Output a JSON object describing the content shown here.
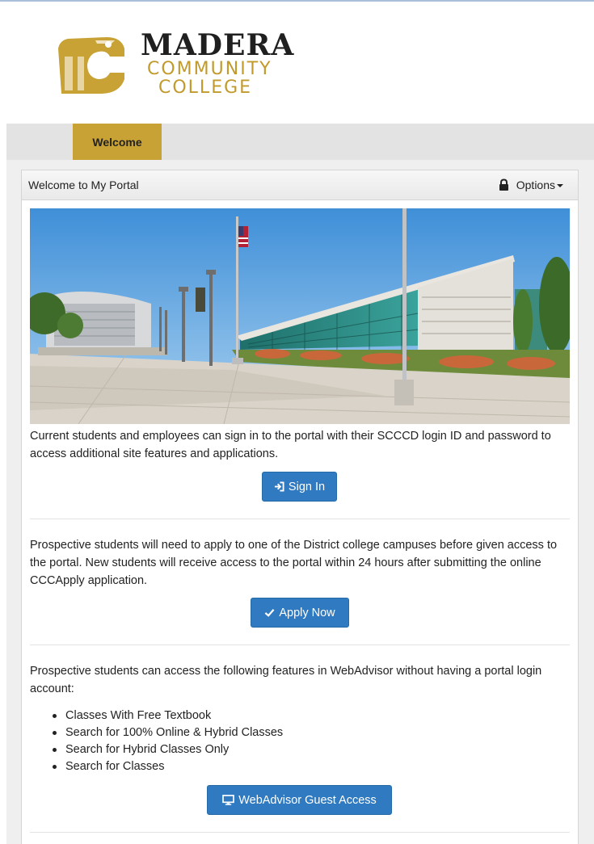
{
  "logo": {
    "line1": "MADERA",
    "line2": "COMMUNITY",
    "line3": "COLLEGE",
    "colors": {
      "gold": "#c9a235",
      "dark": "#1f1f1f"
    }
  },
  "tabs": [
    {
      "label": "Welcome",
      "active": true
    }
  ],
  "panel": {
    "title": "Welcome to My Portal",
    "options_label": "Options",
    "lock_icon": "lock-icon"
  },
  "sections": {
    "signin": {
      "text": "Current students and employees can sign in to the portal with their SCCCD login ID and password to access additional site features and applications.",
      "button": "Sign In",
      "icon": "sign-in-icon"
    },
    "apply": {
      "text": "Prospective students will need to apply to one of the District college campuses before given access to the portal. New students will receive access to the portal within 24 hours after submitting the online CCCApply application.",
      "button": "Apply Now",
      "icon": "check-icon"
    },
    "webadvisor": {
      "text": "Prospective students can access the following features in WebAdvisor without having a portal login account:",
      "features": [
        "Classes With Free Textbook",
        "Search for 100% Online & Hybrid Classes",
        "Search for Hybrid Classes Only",
        "Search for Classes"
      ],
      "button": "WebAdvisor Guest Access",
      "icon": "monitor-icon"
    }
  },
  "colors": {
    "accent_gold": "#c9a235",
    "button_blue": "#2f7ac0",
    "tabbar_gray": "#e3e3e3"
  }
}
